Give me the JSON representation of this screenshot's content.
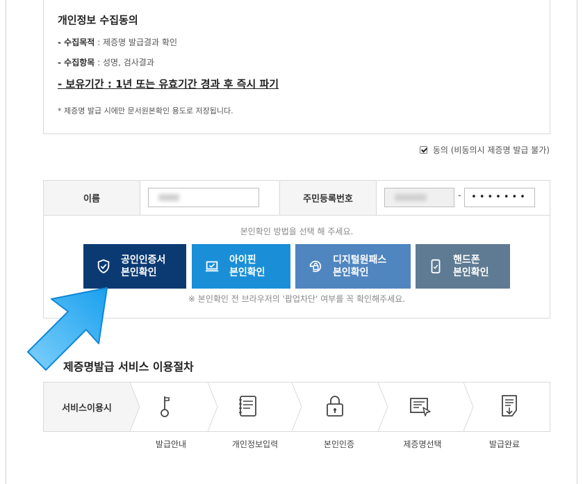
{
  "consent": {
    "title": "개인정보 수집동의",
    "purpose_label": "- 수집목적",
    "purpose_value": " : 제증명 발급결과 확인",
    "items_label": "- 수집항목",
    "items_value": " : 성명, 검사결과",
    "retention": "- 보유기간 : 1년 또는 유효기간 경과 후 즉시 파기",
    "note": "* 제증명 발급 시에만 문서원본확인 용도로 저장됩니다."
  },
  "agree": {
    "label": "동의 (비동의시 제증명 발급 불가)",
    "checked": true
  },
  "identity": {
    "name_label": "이름",
    "rrn_label": "주민등록번호",
    "rrn_dash": "-",
    "rrn_back_masked": "•••••••",
    "method_hint": "본인확인 방법을 선택 해 주세요.",
    "popup_note": "※ 본인확인 전 브라우저의 '팝업차단' 여부를 꼭 확인해주세요."
  },
  "methods": [
    {
      "line1": "공인인증서",
      "line2": "본인확인",
      "icon": "shield-check-icon",
      "color": "#0b3a73"
    },
    {
      "line1": "아이핀",
      "line2": "본인확인",
      "icon": "laptop-check-icon",
      "color": "#1a8fd8"
    },
    {
      "line1": "디지털원패스",
      "line2": "본인확인",
      "icon": "refresh-lock-icon",
      "color": "#4f86c0"
    },
    {
      "line1": "핸드폰",
      "line2": "본인확인",
      "icon": "phone-icon",
      "color": "#5f7b93"
    }
  ],
  "service": {
    "title": "제증명발급 서비스 이용절차",
    "label": "서비스이용시",
    "steps": [
      {
        "label": "발급안내",
        "icon": "key-icon"
      },
      {
        "label": "개인정보입력",
        "icon": "notebook-icon"
      },
      {
        "label": "본인인증",
        "icon": "lock-icon"
      },
      {
        "label": "제증명선택",
        "icon": "document-cursor-icon"
      },
      {
        "label": "발급완료",
        "icon": "document-download-icon"
      }
    ]
  }
}
